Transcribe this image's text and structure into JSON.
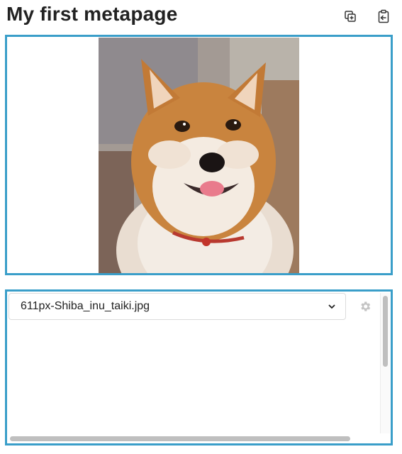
{
  "page": {
    "title": "My first metapage"
  },
  "toolbar": {
    "icons": [
      "copy-add-icon",
      "clipboard-import-icon"
    ]
  },
  "image_panel": {
    "image_subject": "Shiba Inu dog photo"
  },
  "file_selector": {
    "selected_value": "611px-Shiba_inu_taiki.jpg",
    "icons": [
      "chevron-down-icon",
      "gear-icon"
    ]
  },
  "colors": {
    "panel_border": "#3a9ec9",
    "scrollbar_thumb": "#bfbfbf"
  }
}
